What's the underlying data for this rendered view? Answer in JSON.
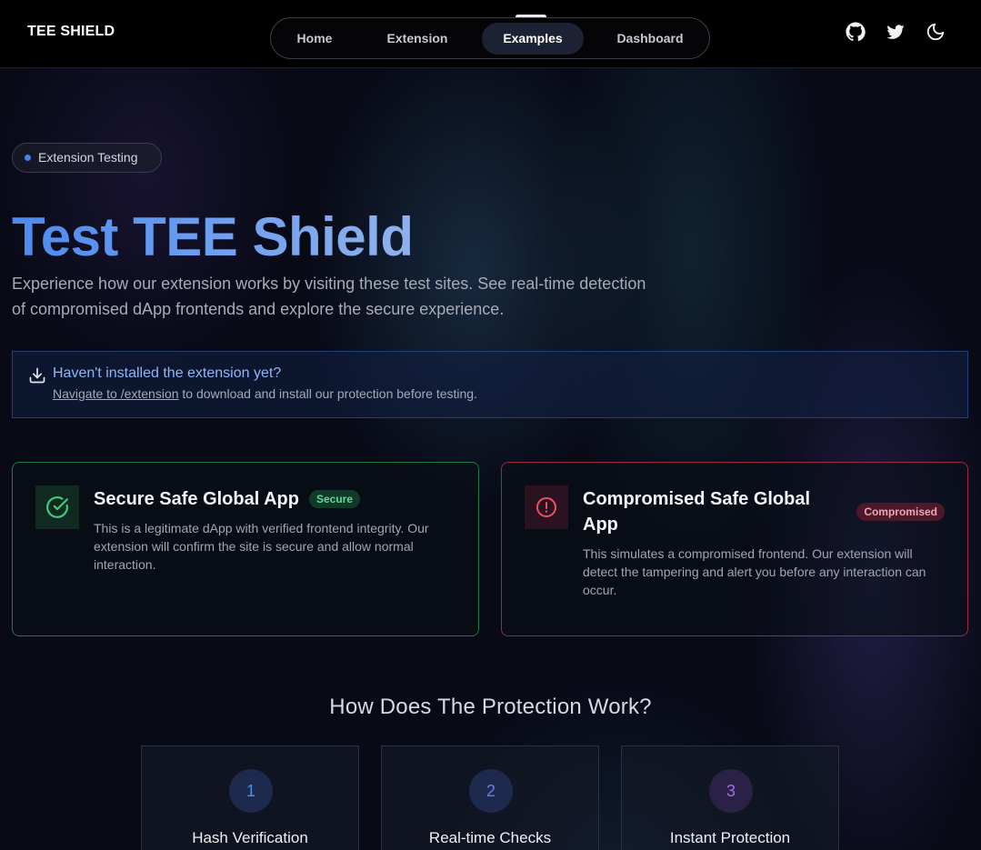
{
  "header": {
    "logo": "TEE SHIELD",
    "nav": [
      {
        "label": "Home",
        "active": false
      },
      {
        "label": "Extension",
        "active": false
      },
      {
        "label": "Examples",
        "active": true
      },
      {
        "label": "Dashboard",
        "active": false
      }
    ],
    "icons": [
      "github-icon",
      "twitter-icon",
      "moon-icon"
    ]
  },
  "hero": {
    "badge": "Extension Testing",
    "title": "Test TEE Shield",
    "subtitle": "Experience how our extension works by visiting these test sites. See real-time detection of compromised dApp frontends and explore the secure experience."
  },
  "notice": {
    "title": "Haven't installed the extension yet?",
    "link": "Navigate to /extension",
    "text": " to download and install our protection before testing."
  },
  "cards": {
    "secure": {
      "title": "Secure Safe Global App",
      "tag": "Secure",
      "description": "This is a legitimate dApp with verified frontend integrity. Our extension will confirm the site is secure and allow normal interaction."
    },
    "compromised": {
      "title": "Compromised Safe Global App",
      "tag": "Compromised",
      "description": "This simulates a compromised frontend. Our extension will detect the tampering and alert you before any interaction can occur."
    }
  },
  "how": {
    "heading": "How Does The Protection Work?",
    "steps": [
      {
        "num": "1",
        "title": "Hash Verification",
        "color": "#4f8df0"
      },
      {
        "num": "2",
        "title": "Real-time Checks",
        "color": "#6b79e8"
      },
      {
        "num": "3",
        "title": "Instant Protection",
        "color": "#a46be8"
      }
    ]
  }
}
